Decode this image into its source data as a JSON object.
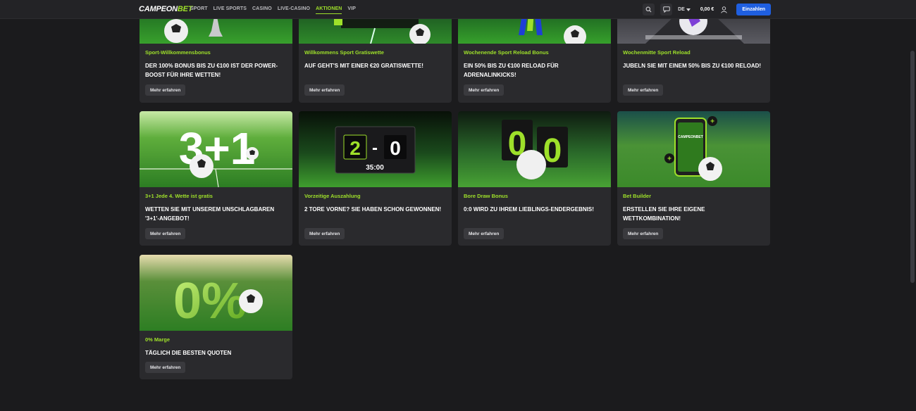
{
  "header": {
    "logo_part1": "CAMPEON",
    "logo_part2": "BET",
    "nav": [
      "SPORT",
      "LIVE SPORTS",
      "CASINO",
      "LIVE-CASINO",
      "AKTIONEN",
      "VIP"
    ],
    "active_nav": "AKTIONEN",
    "language": "DE",
    "balance": "0,00 €",
    "login_label": "Einzahlen",
    "icons": [
      "search-icon",
      "chat-icon",
      "user-icon"
    ]
  },
  "promo_cards": [
    {
      "category": "Sport-Willkommensbonus",
      "title": "DER 100% BONUS BIS ZU €100 IST DER POWER-BOOST FÜR IHRE WETTEN!",
      "button": "Mehr erfahren"
    },
    {
      "category": "Willkommens Sport Gratiswette",
      "title": "AUF GEHT'S MIT EINER €20 GRATISWETTE!",
      "button": "Mehr erfahren"
    },
    {
      "category": "Wochenende Sport Reload Bonus",
      "title": "EIN 50% BIS ZU €100 RELOAD FÜR ADRENALINKICKS!",
      "button": "Mehr erfahren"
    },
    {
      "category": "Wochenmitte Sport Reload",
      "title": "JUBELN SIE MIT EINEM 50% BIS ZU €100 RELOAD!",
      "button": "Mehr erfahren"
    },
    {
      "category": "3+1 Jede 4. Wette ist gratis",
      "title": "WETTEN SIE MIT UNSEREM UNSCHLAGBAREN '3+1'-ANGEBOT!",
      "button": "Mehr erfahren",
      "image_text": "3+1"
    },
    {
      "category": "Vorzeitige Auszahlung",
      "title": "2 TORE VORNE? SIE HABEN SCHON GEWONNEN!",
      "button": "Mehr erfahren",
      "image_text": {
        "home": "2",
        "sep": "-",
        "away": "0",
        "time": "35:00"
      }
    },
    {
      "category": "Bore Draw Bonus",
      "title": "0:0 WIRD ZU IHREM LIEBLINGS-ENDERGEBNIS!",
      "button": "Mehr erfahren",
      "image_text": {
        "home": "0",
        "away": "0"
      }
    },
    {
      "category": "Bet Builder",
      "title": "ERSTELLEN SIE IHRE EIGENE WETTKOMBINATION!",
      "button": "Mehr erfahren",
      "image_text": "CAMPEONBET"
    },
    {
      "category": "0% Marge",
      "title": "TÄGLICH DIE BESTEN QUOTEN",
      "button": "Mehr erfahren",
      "image_text": "0%"
    }
  ],
  "colors": {
    "accent": "#9ee02a",
    "background": "#1b1b1d",
    "card": "#2a2a2d",
    "login": "#1f5fe0"
  }
}
